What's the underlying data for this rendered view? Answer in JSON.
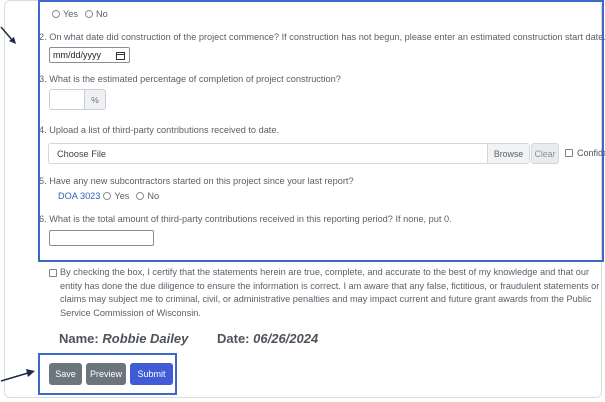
{
  "q1": {
    "options": [
      "Yes",
      "No"
    ]
  },
  "q2": {
    "question": "2. On what date did construction of the project commence? If construction has not begun, please enter an estimated construction start date.",
    "date_placeholder": "mm/dd/yyyy"
  },
  "q3": {
    "question": "3. What is the estimated percentage of completion of project construction?",
    "addon": "%"
  },
  "q4": {
    "question": "4. Upload a list of third-party contributions received to date.",
    "file_label": "Choose File",
    "browse_label": "Browse",
    "clear_label": "Clear",
    "confidential_label": "Confidential"
  },
  "q5": {
    "question": "5. Have any new subcontractors started on this project since your last report?",
    "link": "DOA 3023",
    "options": [
      "Yes",
      "No"
    ]
  },
  "q6": {
    "question": "6. What is the total amount of third-party contributions received in this reporting period? If none, put 0."
  },
  "certification": {
    "text": "By checking the box, I certify that the statements herein are true, complete, and accurate to the best of my knowledge and that our entity has done the due diligence to ensure the information is correct. I am aware that any false, fictitious, or fraudulent statements or claims may subject me to criminal, civil, or administrative penalties and may impact current and future grant awards from the Public Service Commission of Wisconsin."
  },
  "signature": {
    "name_label": "Name:",
    "name_value": "Robbie Dailey",
    "date_label": "Date:",
    "date_value": "06/26/2024"
  },
  "buttons": {
    "save": "Save",
    "preview": "Preview",
    "submit": "Submit"
  },
  "colors": {
    "highlight": "#3d68c8",
    "submit": "#3f5bd6",
    "secondary": "#6c757d",
    "link": "#2f5fb3"
  }
}
